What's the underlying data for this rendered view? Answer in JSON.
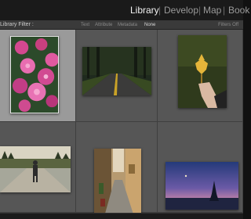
{
  "modules": {
    "library": "Library",
    "develop": "Develop",
    "map": "Map",
    "book": "Book"
  },
  "filter_bar": {
    "title": "Library Filter :",
    "options": [
      "Text",
      "Attribute",
      "Metadata",
      "None"
    ],
    "active_option": "None",
    "filters_off": "Filters Off"
  },
  "grid": {
    "photos": [
      {
        "id": "dahlia-flowers-photo",
        "selected": true
      },
      {
        "id": "forest-road-photo",
        "selected": false
      },
      {
        "id": "autumn-leaf-photo",
        "selected": false
      },
      {
        "id": "hiker-path-photo",
        "selected": false
      },
      {
        "id": "narrow-street-photo",
        "selected": false
      },
      {
        "id": "twilight-lake-photo",
        "selected": false
      }
    ]
  },
  "colors": {
    "app_background": "#111111",
    "cell_background": "#565656",
    "selected_cell": "#9a9a9a",
    "active_module": "#f2f2f2"
  }
}
